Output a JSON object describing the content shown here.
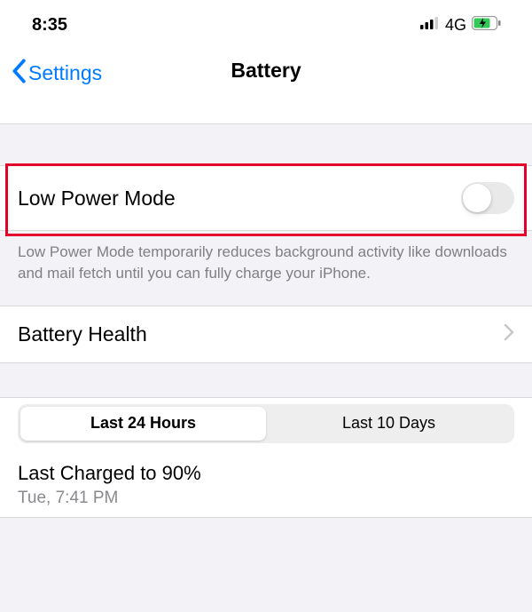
{
  "status": {
    "time": "8:35",
    "network": "4G"
  },
  "nav": {
    "back_label": "Settings",
    "title": "Battery"
  },
  "low_power": {
    "label": "Low Power Mode",
    "description": "Low Power Mode temporarily reduces background activity like downloads and mail fetch until you can fully charge your iPhone."
  },
  "battery_health": {
    "label": "Battery Health"
  },
  "segments": {
    "tab1": "Last 24 Hours",
    "tab2": "Last 10 Days"
  },
  "charge": {
    "title": "Last Charged to 90%",
    "sub": "Tue, 7:41 PM"
  }
}
